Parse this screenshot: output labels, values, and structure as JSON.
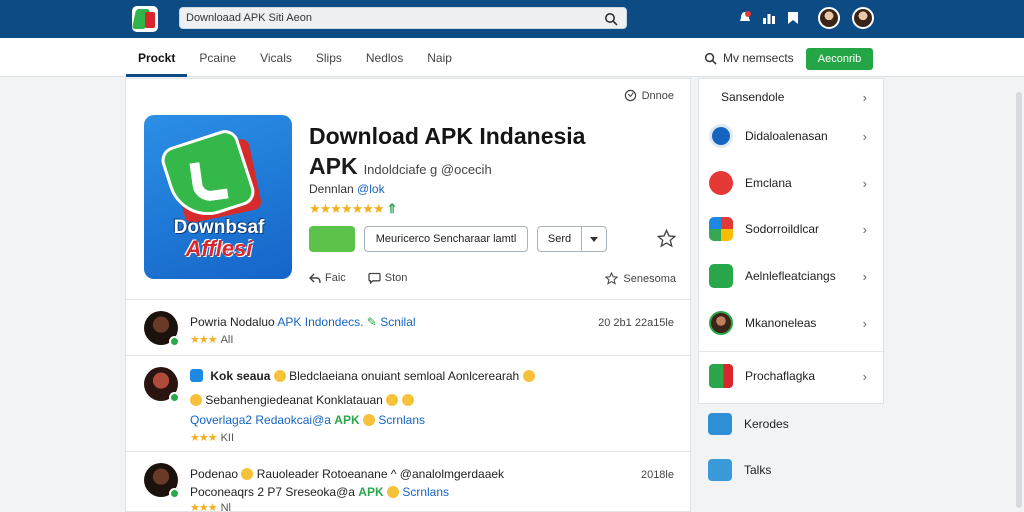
{
  "topbar": {
    "search_value": "Downloaad APK Siti Aeon",
    "colors": {
      "bar": "#0c4b83",
      "accent_green": "#24a646"
    }
  },
  "nav": {
    "tabs": [
      {
        "label": "Prockt",
        "active": true
      },
      {
        "label": "Pcaine",
        "active": false
      },
      {
        "label": "Vicals",
        "active": false
      },
      {
        "label": "Slips",
        "active": false
      },
      {
        "label": "Nedlos",
        "active": false
      },
      {
        "label": "Naip",
        "active": false
      }
    ],
    "search_label": "Mv nemsects",
    "green_button": "Aeconrib"
  },
  "app": {
    "language": "Dnnoe",
    "icon_text_1": "Downbsaf",
    "icon_text_2": "Afflesi",
    "title_line1": "Download APK Indanesia",
    "title_line2": "APK",
    "title_line2_small": "Indoldciafe g @ocecih",
    "developer_prefix": "Dennlan",
    "developer_link": "@lok",
    "stars": "★★★★★★★",
    "stars_extra": "⇑",
    "secondary_button": "Meuricerco Sencharaar lamtl",
    "split_button": "Serd",
    "action_1": "Faic",
    "action_2": "Ston",
    "share_label": "Senesoma"
  },
  "reviews": [
    {
      "name": "Powria Nodaluo",
      "link": "APK Indondecs.",
      "suffix": "Scnilal",
      "date": "20 2b1 22a15le",
      "stars": "★★★",
      "stars_text": "AlI"
    },
    {
      "line1_bold": "Kok seaua",
      "line1_text": "Bledclaeiana onuiant semloal Aonlcerearah",
      "line2_text": "Sebanhengiedeanat Konklatauan",
      "line3_prefix": "Qoverlaga2 Redaokcai@a",
      "line3_green": "APK",
      "line3_suffix": "Scrnlans",
      "stars": "★★★",
      "stars_text": "KII"
    },
    {
      "name": "Podenao",
      "text": "Rauoleader Rotoeanane ^ @analolmgerdaaek",
      "date": "2018le",
      "line2_prefix": "Poconeaqrs 2 P7 Sreseoka@a",
      "line2_green": "APK",
      "line2_suffix": "Scrnlans",
      "stars": "★★★",
      "stars_text": "Nl"
    }
  ],
  "sidebar": {
    "items": [
      {
        "label": "Sansendole",
        "icon": "none"
      },
      {
        "label": "Didaloalenasan",
        "icon": "clock-icon",
        "color": "#1565c0"
      },
      {
        "label": "Emclana",
        "icon": "chat-icon",
        "color": "#e53935"
      },
      {
        "label": "Sodorroildlcar",
        "icon": "colorful-app-icon",
        "color": "#34a853"
      },
      {
        "label": "Aelnlefleatciangs",
        "icon": "phone-icon",
        "color": "#2aa74a"
      },
      {
        "label": "Mkanoneleas",
        "icon": "avatar-icon",
        "color": "#5d3a2a"
      },
      {
        "label": "Prochaflagka",
        "icon": "flag-app-icon",
        "color": "#2aa74a"
      }
    ],
    "lower_items": [
      {
        "label": "Kerodes",
        "icon": "inbox-icon"
      },
      {
        "label": "Talks",
        "icon": "image-icon"
      }
    ]
  }
}
